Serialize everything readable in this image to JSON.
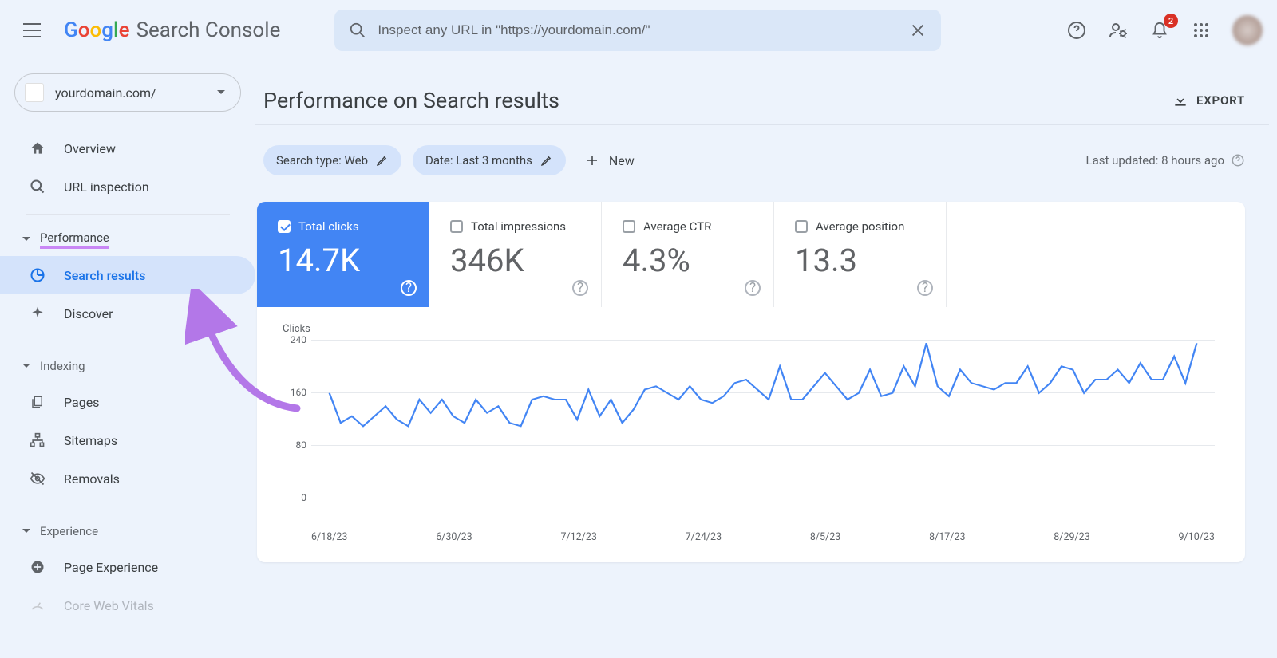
{
  "header": {
    "logo_text_a": "G",
    "logo_text_b": "o",
    "logo_text_c": "o",
    "logo_text_d": "g",
    "logo_text_e": "l",
    "logo_text_f": "e",
    "app_name": "Search Console",
    "search_placeholder": "Inspect any URL in \"https://yourdomain.com/\"",
    "notification_badge": "2"
  },
  "property": {
    "domain": "yourdomain.com/"
  },
  "sidebar": {
    "overview": "Overview",
    "url_inspection": "URL inspection",
    "performance_section": "Performance",
    "search_results": "Search results",
    "discover": "Discover",
    "indexing_section": "Indexing",
    "pages": "Pages",
    "sitemaps": "Sitemaps",
    "removals": "Removals",
    "experience_section": "Experience",
    "page_experience": "Page Experience",
    "core_web_vitals": "Core Web Vitals"
  },
  "main": {
    "title": "Performance on Search results",
    "export": "EXPORT",
    "filter_search_type": "Search type: Web",
    "filter_date": "Date: Last 3 months",
    "new_btn": "New",
    "last_updated": "Last updated: 8 hours ago"
  },
  "metrics": {
    "total_clicks_label": "Total clicks",
    "total_clicks_value": "14.7K",
    "total_impressions_label": "Total impressions",
    "total_impressions_value": "346K",
    "avg_ctr_label": "Average CTR",
    "avg_ctr_value": "4.3%",
    "avg_position_label": "Average position",
    "avg_position_value": "13.3"
  },
  "chart": {
    "y_label": "Clicks",
    "y_ticks": [
      "240",
      "160",
      "80",
      "0"
    ],
    "x_ticks": [
      "6/18/23",
      "6/30/23",
      "7/12/23",
      "7/24/23",
      "8/5/23",
      "8/17/23",
      "8/29/23",
      "9/10/23"
    ]
  },
  "chart_data": {
    "type": "line",
    "title": "Clicks",
    "ylabel": "Clicks",
    "ylim": [
      0,
      240
    ],
    "categories": [
      "6/18/23",
      "6/30/23",
      "7/12/23",
      "7/24/23",
      "8/5/23",
      "8/17/23",
      "8/29/23",
      "9/10/23"
    ],
    "series": [
      {
        "name": "Total clicks",
        "values": [
          160,
          115,
          125,
          110,
          125,
          140,
          120,
          110,
          150,
          130,
          150,
          125,
          115,
          150,
          130,
          140,
          115,
          110,
          150,
          155,
          150,
          150,
          120,
          165,
          125,
          150,
          115,
          135,
          165,
          170,
          160,
          150,
          170,
          150,
          145,
          155,
          175,
          180,
          165,
          150,
          200,
          150,
          150,
          170,
          190,
          170,
          150,
          160,
          195,
          155,
          160,
          200,
          170,
          235,
          170,
          155,
          195,
          175,
          170,
          165,
          175,
          175,
          200,
          160,
          175,
          200,
          195,
          160,
          180,
          180,
          195,
          175,
          205,
          180,
          180,
          215,
          175,
          235
        ]
      }
    ]
  }
}
